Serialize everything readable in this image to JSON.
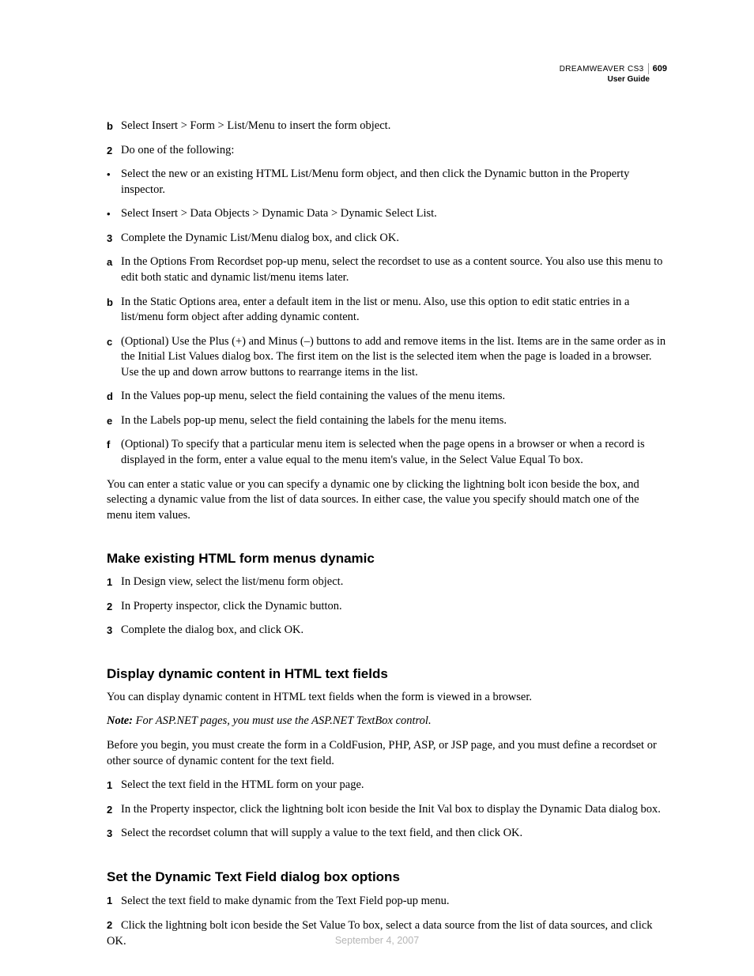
{
  "header": {
    "product": "DREAMWEAVER CS3",
    "guide": "User Guide",
    "page_number": "609"
  },
  "top_list": [
    {
      "marker": "b",
      "text": "Select Insert > Form > List/Menu to insert the form object."
    },
    {
      "marker": "2",
      "text": "Do one of the following:"
    },
    {
      "marker": "•",
      "text": "Select the new or an existing HTML List/Menu form object, and then click the Dynamic button in the Property inspector."
    },
    {
      "marker": "•",
      "text": "Select Insert > Data Objects > Dynamic Data > Dynamic Select List."
    },
    {
      "marker": "3",
      "text": "Complete the Dynamic List/Menu dialog box, and click OK."
    },
    {
      "marker": "a",
      "text": "In the Options From Recordset pop-up menu, select the recordset to use as a content source. You also use this menu to edit both static and dynamic list/menu items later."
    },
    {
      "marker": "b",
      "text": "In the Static Options area, enter a default item in the list or menu. Also, use this option to edit static entries in a list/menu form object after adding dynamic content."
    },
    {
      "marker": "c",
      "text": "(Optional) Use the Plus (+) and Minus (–) buttons to add and remove items in the list. Items are in the same order as in the Initial List Values dialog box. The first item on the list is the selected item when the page is loaded in a browser. Use the up and down arrow buttons to rearrange items in the list."
    },
    {
      "marker": "d",
      "text": "In the Values pop-up menu, select the field containing the values of the menu items."
    },
    {
      "marker": "e",
      "text": "In the Labels pop-up menu, select the field containing the labels for the menu items."
    },
    {
      "marker": "f",
      "text": "(Optional) To specify that a particular menu item is selected when the page opens in a browser or when a record is displayed in the form, enter a value equal to the menu item's value, in the Select Value Equal To box."
    }
  ],
  "top_para": "You can enter a static value or you can specify a dynamic one by clicking the lightning bolt icon beside the box, and selecting a dynamic value from the list of data sources. In either case, the value you specify should match one of the menu item values.",
  "section1": {
    "heading": "Make existing HTML form menus dynamic",
    "items": [
      {
        "marker": "1",
        "text": "In Design view, select the list/menu form object."
      },
      {
        "marker": "2",
        "text": "In Property inspector, click the Dynamic button."
      },
      {
        "marker": "3",
        "text": "Complete the dialog box, and click OK."
      }
    ]
  },
  "section2": {
    "heading": "Display dynamic content in HTML text fields",
    "intro": "You can display dynamic content in HTML text fields when the form is viewed in a browser.",
    "note_label": "Note:",
    "note_body": " For ASP.NET pages, you must use the ASP.NET TextBox control.",
    "before": "Before you begin, you must create the form in a ColdFusion, PHP, ASP, or JSP page, and you must define a recordset or other source of dynamic content for the text field.",
    "items": [
      {
        "marker": "1",
        "text": "Select the text field in the HTML form on your page."
      },
      {
        "marker": "2",
        "text": "In the Property inspector, click the lightning bolt icon beside the Init Val box to display the Dynamic Data dialog box."
      },
      {
        "marker": "3",
        "text": "Select the recordset column that will supply a value to the text field, and then click OK."
      }
    ]
  },
  "section3": {
    "heading": "Set the Dynamic Text Field dialog box options",
    "items": [
      {
        "marker": "1",
        "text": "Select the text field to make dynamic from the Text Field pop-up menu."
      },
      {
        "marker": "2",
        "text": "Click the lightning bolt icon beside the Set Value To box, select a data source from the list of data sources, and click OK."
      }
    ]
  },
  "footer_date": "September 4, 2007"
}
